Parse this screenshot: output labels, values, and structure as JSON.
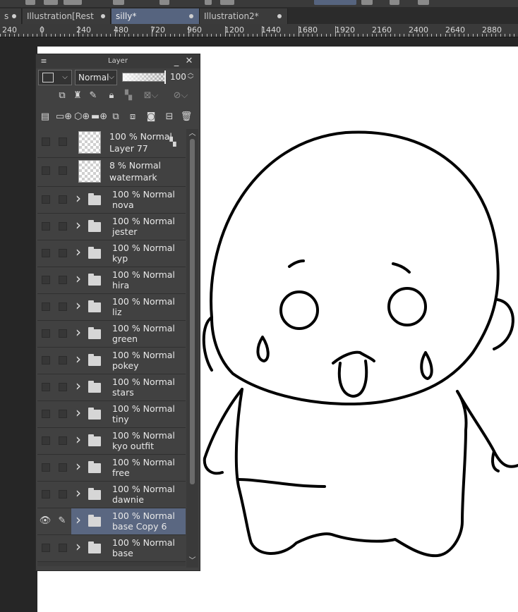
{
  "tabs": [
    {
      "label": "s",
      "active": false
    },
    {
      "label": "Illustration[Rest",
      "active": false
    },
    {
      "label": "silly*",
      "active": true
    },
    {
      "label": "Illustration2*",
      "active": false
    }
  ],
  "ruler": [
    "240",
    "0",
    "240",
    "480",
    "720",
    "960",
    "1200",
    "1440",
    "1680",
    "1920",
    "2160",
    "2400",
    "2640",
    "2880"
  ],
  "panel": {
    "title": "Layer",
    "blend_mode": "Normal",
    "opacity": "100",
    "icons": {
      "menu": "hamburger-icon",
      "minimize": "minimize-icon",
      "close": "close-icon",
      "color": "layer-color-icon",
      "ref": "reference-layer-icon",
      "draft": "draft-layer-icon",
      "lock": "lock-icon",
      "lock_transparent": "lock-transparency-icon",
      "clip": "clip-icon",
      "mask": "mask-icon",
      "new_raster": "new-raster-layer-icon",
      "new_vector": "new-vector-layer-icon",
      "new_folder": "new-folder-icon",
      "transfer": "transfer-layer-icon",
      "combine": "combine-layer-icon",
      "layer_mask": "layer-mask-icon",
      "apply_mask": "apply-mask-icon",
      "delete": "trash-icon",
      "eye": "eye-icon",
      "pen": "pen-icon"
    }
  },
  "layers": [
    {
      "mode": "100 % Normal",
      "name": "Layer 77",
      "type": "raster",
      "visible": false,
      "editing": false,
      "selected": false
    },
    {
      "mode": "8 % Normal",
      "name": "watermark",
      "type": "raster",
      "visible": false,
      "editing": false,
      "selected": false
    },
    {
      "mode": "100 % Normal",
      "name": "nova",
      "type": "folder",
      "visible": false,
      "editing": false,
      "selected": false
    },
    {
      "mode": "100 % Normal",
      "name": "jester",
      "type": "folder",
      "visible": false,
      "editing": false,
      "selected": false
    },
    {
      "mode": "100 % Normal",
      "name": "kyp",
      "type": "folder",
      "visible": false,
      "editing": false,
      "selected": false
    },
    {
      "mode": "100 % Normal",
      "name": "hira",
      "type": "folder",
      "visible": false,
      "editing": false,
      "selected": false
    },
    {
      "mode": "100 % Normal",
      "name": "liz",
      "type": "folder",
      "visible": false,
      "editing": false,
      "selected": false
    },
    {
      "mode": "100 % Normal",
      "name": "green",
      "type": "folder",
      "visible": false,
      "editing": false,
      "selected": false
    },
    {
      "mode": "100 % Normal",
      "name": "pokey",
      "type": "folder",
      "visible": false,
      "editing": false,
      "selected": false
    },
    {
      "mode": "100 % Normal",
      "name": "stars",
      "type": "folder",
      "visible": false,
      "editing": false,
      "selected": false
    },
    {
      "mode": "100 % Normal",
      "name": "tiny",
      "type": "folder",
      "visible": false,
      "editing": false,
      "selected": false
    },
    {
      "mode": "100 % Normal",
      "name": "kyo outfit",
      "type": "folder",
      "visible": false,
      "editing": false,
      "selected": false
    },
    {
      "mode": "100 % Normal",
      "name": "free",
      "type": "folder",
      "visible": false,
      "editing": false,
      "selected": false
    },
    {
      "mode": "100 % Normal",
      "name": "dawnie",
      "type": "folder",
      "visible": false,
      "editing": false,
      "selected": false
    },
    {
      "mode": "100 % Normal",
      "name": "base Copy 6",
      "type": "folder",
      "visible": true,
      "editing": true,
      "selected": true
    },
    {
      "mode": "100 % Normal",
      "name": "base",
      "type": "folder",
      "visible": false,
      "editing": false,
      "selected": false
    }
  ],
  "colors": {
    "selected_row": "#5a6781",
    "active_tab": "#56647f",
    "panel_bg": "#414141"
  }
}
